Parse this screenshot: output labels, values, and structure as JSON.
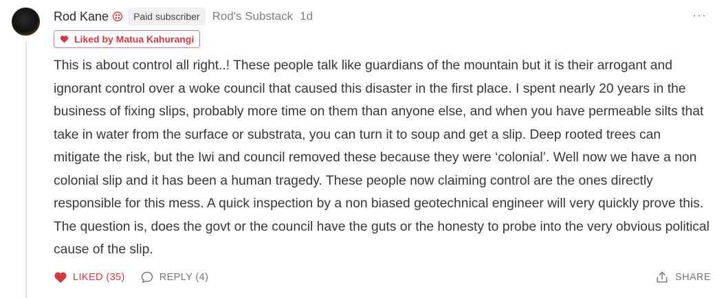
{
  "comment": {
    "author": "Rod Kane",
    "subscriber_badge": "Paid subscriber",
    "publication": "Rod's Substack",
    "time_ago": "1d",
    "more_label": "···",
    "liked_by": "Liked by Matua Kahurangi",
    "body": "This is about control all right..! These people talk like guardians of the mountain but it is their arrogant and ignorant control over a woke council that caused this disaster in the first place. I spent nearly 20 years in the business of fixing slips, probably more time on them than anyone else, and when you have permeable silts that take in water from the surface or substrata, you can turn it to soup and get a slip. Deep rooted trees can mitigate the risk, but the Iwi and council removed these because they were ‘colonial’. Well now we have a non colonial slip and it has been a human tragedy. These people now claiming control are the ones directly responsible for this mess. A quick inspection by a non biased geotechnical engineer will very quickly prove this. The question is, does the govt or the council have the guts or the honesty to probe into the very obvious political cause of the slip."
  },
  "actions": {
    "like_label": "LIKED (35)",
    "reply_label": "REPLY (4)",
    "share_label": "SHARE"
  },
  "icons": {
    "badge": "founding-member-icon",
    "heart": "heart-icon",
    "reply": "speech-bubble-icon",
    "share": "share-icon",
    "more": "more-dots-icon"
  },
  "colors": {
    "accent_red": "#d9363e",
    "muted_gray": "#808080",
    "pill_bg": "#f0f0f0"
  }
}
